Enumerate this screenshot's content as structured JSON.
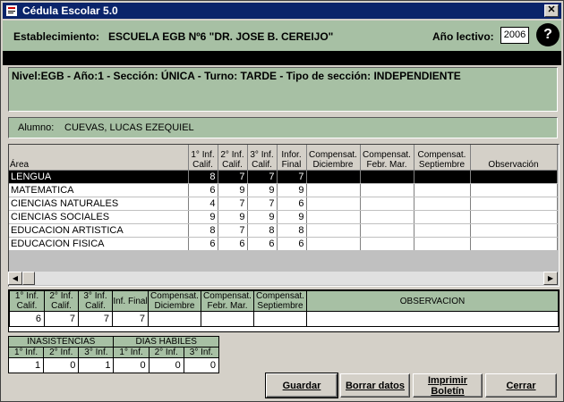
{
  "window": {
    "title": "Cédula Escolar 5.0",
    "close": "✕"
  },
  "header": {
    "est_label": "Establecimiento:",
    "est_value": "ESCUELA EGB Nº6 \"DR. JOSE B. CEREIJO\"",
    "year_label": "Año lectivo:",
    "year_value": "2006",
    "help": "?"
  },
  "nivel": "Nivel:EGB - Año:1 - Sección: ÚNICA - Turno: TARDE - Tipo de sección: INDEPENDIENTE",
  "alumno": {
    "label": "Alumno:",
    "value": "CUEVAS, LUCAS EZEQUIEL"
  },
  "grid": {
    "headers": [
      "Área",
      "1° Inf. Calif.",
      "2° Inf. Calif.",
      "3° Inf. Calif.",
      "Infor. Final",
      "Compensat. Diciembre",
      "Compensat. Febr. Mar.",
      "Compensat. Septiembre",
      "Observación"
    ],
    "rows": [
      [
        "LENGUA",
        "8",
        "7",
        "7",
        "7",
        "",
        "",
        "",
        ""
      ],
      [
        "MATEMATICA",
        "6",
        "9",
        "9",
        "9",
        "",
        "",
        "",
        ""
      ],
      [
        "CIENCIAS NATURALES",
        "4",
        "7",
        "7",
        "6",
        "",
        "",
        "",
        ""
      ],
      [
        "CIENCIAS SOCIALES",
        "9",
        "9",
        "9",
        "9",
        "",
        "",
        "",
        ""
      ],
      [
        "EDUCACION ARTISTICA",
        "8",
        "7",
        "8",
        "8",
        "",
        "",
        "",
        ""
      ],
      [
        "EDUCACION FISICA",
        "6",
        "6",
        "6",
        "6",
        "",
        "",
        "",
        ""
      ]
    ]
  },
  "detail": {
    "headers": [
      "1° Inf. Calif.",
      "2° Inf. Calif.",
      "3° Inf. Calif.",
      "Inf. Final",
      "Compensat. Diciembre",
      "Compensat. Febr. Mar.",
      "Compensat. Septiembre",
      "OBSERVACION"
    ],
    "values": [
      "6",
      "7",
      "7",
      "7",
      "",
      "",
      "",
      ""
    ]
  },
  "inasistencias": {
    "group1": "INASISTENCIAS",
    "group2": "DIAS HABILES",
    "headers": [
      "1° Inf.",
      "2° Inf.",
      "3° Inf.",
      "1° Inf.",
      "2° Inf.",
      "3° Inf."
    ],
    "values": [
      "1",
      "0",
      "1",
      "0",
      "0",
      "0"
    ]
  },
  "buttons": {
    "guardar": "Guardar",
    "borrar": "Borrar datos",
    "imprimir": "Imprimir Boletín",
    "cerrar": "Cerrar"
  },
  "colors": {
    "panel": "#a7c0a4",
    "title": "#0a246a"
  }
}
